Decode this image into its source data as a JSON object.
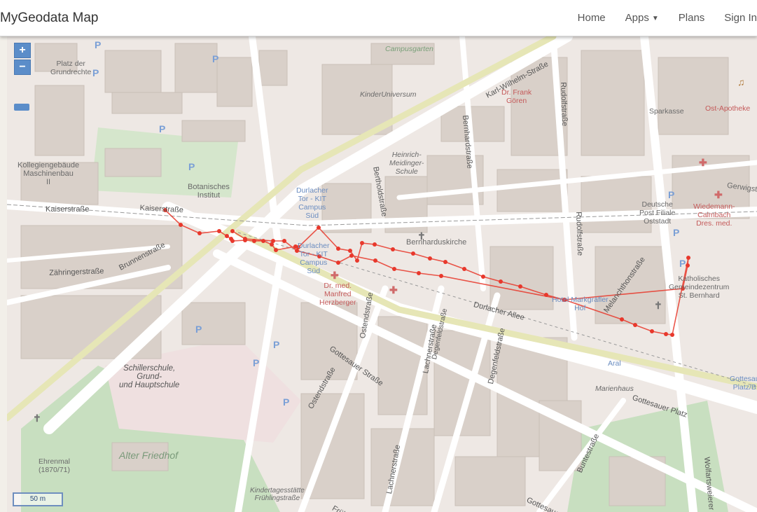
{
  "navbar": {
    "brand": "MyGeodata Map",
    "items": {
      "home": "Home",
      "apps": "Apps",
      "plans": "Plans",
      "signin": "Sign In"
    }
  },
  "map": {
    "zoom_in": "+",
    "zoom_out": "−",
    "scale_label": "50 m",
    "track_color": "#e8382c",
    "labels": {
      "platz": "Platz der\nGrundrechte",
      "kollegiengebaeude": "Kollegiengebäude\nMaschinenbau\nII",
      "botanisches": "Botanisches\nInstitut",
      "campusgarten": "Campusgarten",
      "kinderuniversum": "KinderUniversum",
      "heinrich": "Heinrich-\nMeidinger-\nSchule",
      "durlacher_tor_kit": "Durlacher\nTor - KIT\nCampus\nSüd",
      "durlacher_campus": "Durlacher\nTor - KIT\nCampus\nSüd",
      "bernharduskirche": "Bernharduskirche",
      "dr_goren": "Dr. Frank\nGören",
      "sparkasse": "Sparkasse",
      "ost_apotheke": "Ost-Apotheke",
      "deutsche_post": "Deutsche\nPost Filiale\nOststadt",
      "wiedemann": "Wiedemann-\nCalmbach\nDres. med.",
      "katholisches": "Katholisches\nGemeindezentrum\nSt. Bernhard",
      "markgraefler": "Hotel Markgräfler\nHof",
      "dr_herzberger": "Dr. med.\nManfred\nHerzberger",
      "schillerschule": "Schillerschule,\nGrund-\nund Hauptschule",
      "alter_friedhof": "Alter Friedhof",
      "ehrenmal": "Ehrenmal\n(1870/71)",
      "kindertagesstaette": "Kindertagesstätte\nFrühlingstraße",
      "aral": "Aral",
      "marienhaus": "Marienhaus",
      "gottesaue": "Gottesau\nPlatz/B",
      "gerwigstr": "Gerwigstr"
    },
    "streets": {
      "kaiserstrasse": "Kaiserstraße",
      "kaiserstrasse2": "Kaiserstraße",
      "zaehringer": "Zähringerstraße",
      "brunnenstrasse": "Brunnenstraße",
      "karl_wilhelm": "Karl-Wilhelm-Straße",
      "bernhardstrasse": "Bernhardstraße",
      "rudolfstrasse": "Rudolfstraße",
      "rudolfstrasse2": "Rudolfstraße",
      "berthold": "Bertholdstraße",
      "ostend": "Ostendstraße",
      "ostend2": "Ostendstraße",
      "lachner": "Lachnerstraße",
      "lachner2": "Lachnerstraße",
      "degenfeld": "Degenfeldstraße",
      "degenfeld2": "Degenfeldstraße",
      "durlacher_allee": "Durlacher Allee",
      "gottesauer_strasse": "Gottesauer Straße",
      "gottesauer_platz": "Gottesauer Platz",
      "melanchthon": "Melanchthonstraße",
      "wolfartsweierer": "Wolfartsweierer",
      "buntestrasse": "Buntestraße",
      "fruehl": "Frühl",
      "gottesauer_bottom": "Gottesauer"
    }
  }
}
